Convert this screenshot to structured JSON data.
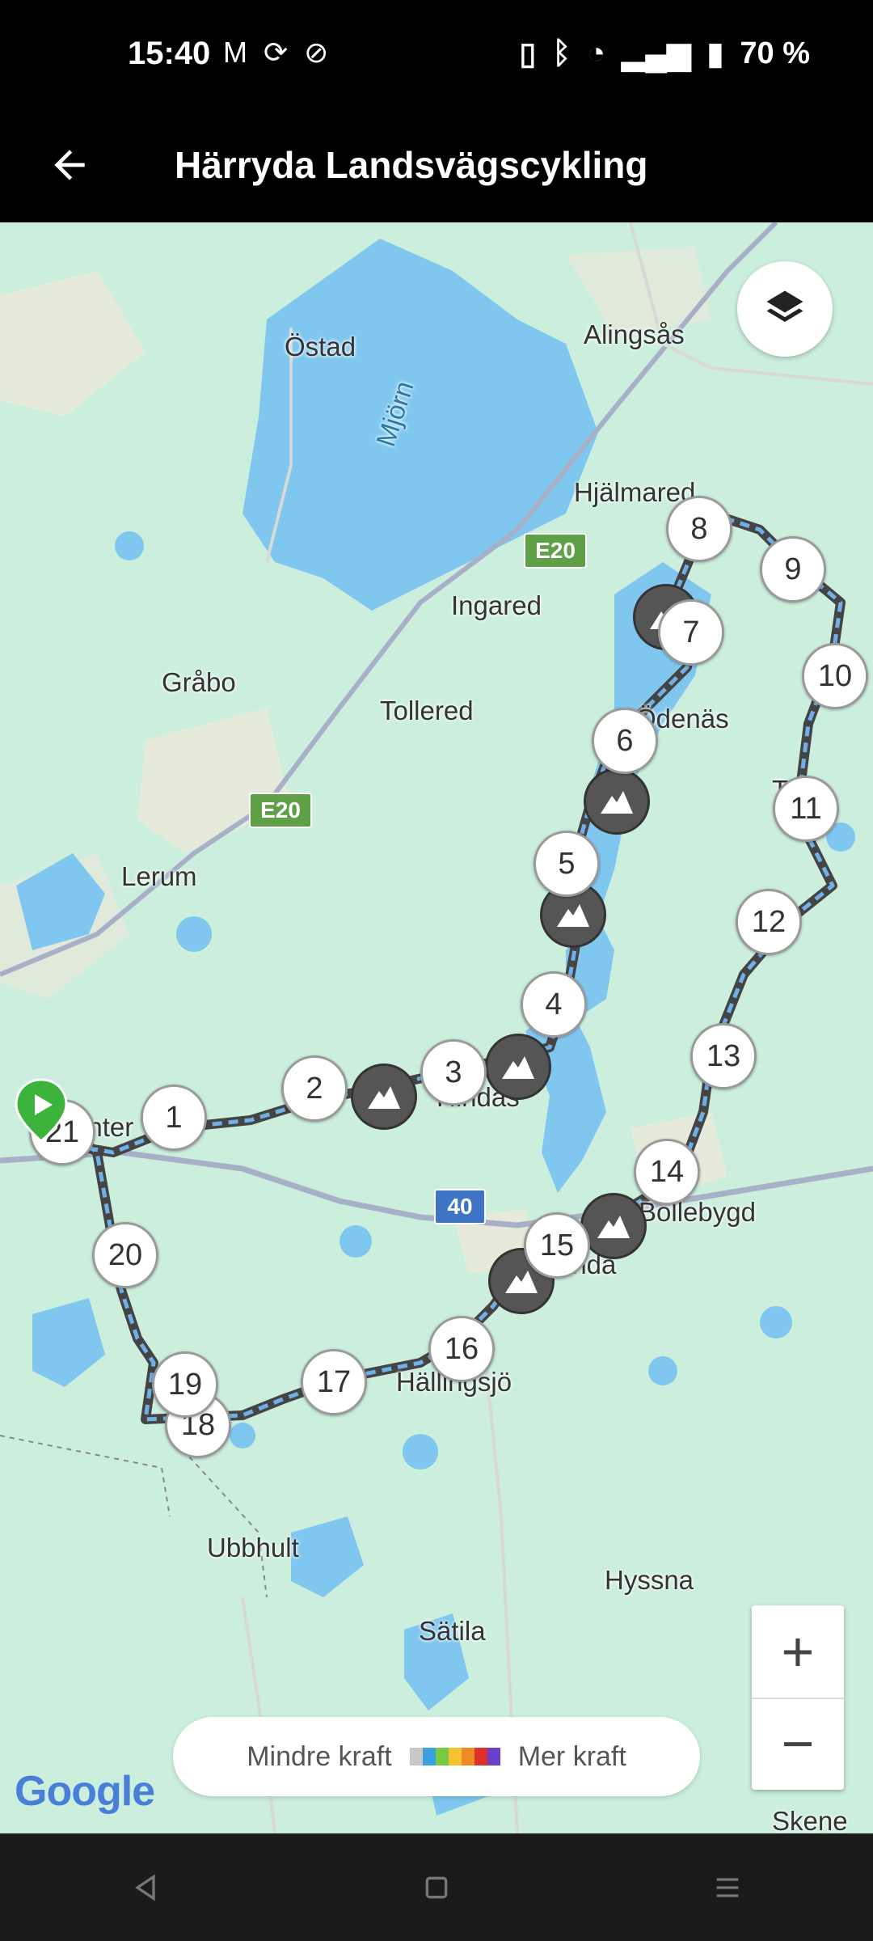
{
  "status_bar": {
    "time": "15:40",
    "left_icons": [
      "gmail-icon",
      "sync-icon",
      "no-disturb-icon"
    ],
    "battery": "70 %"
  },
  "header": {
    "title": "Härryda Landsvägscykling"
  },
  "map": {
    "places": [
      {
        "id": "ostad",
        "label": "Östad"
      },
      {
        "id": "alingsas",
        "label": "Alingsås"
      },
      {
        "id": "mjorn",
        "label": "Mjörn"
      },
      {
        "id": "hjalmared",
        "label": "Hjälmared"
      },
      {
        "id": "ingared",
        "label": "Ingared"
      },
      {
        "id": "grabo",
        "label": "Gråbo"
      },
      {
        "id": "tollered",
        "label": "Tollered"
      },
      {
        "id": "odenas",
        "label": "Ödenäs"
      },
      {
        "id": "lerum",
        "label": "Lerum"
      },
      {
        "id": "hindas",
        "label": "Hindås"
      },
      {
        "id": "bollebygd",
        "label": "Bollebygd"
      },
      {
        "id": "rannebergen",
        "label": "anter"
      },
      {
        "id": "hallingsjo",
        "label": "Hällingsjö"
      },
      {
        "id": "rinda",
        "label": "inda"
      },
      {
        "id": "ubbhult",
        "label": "Ubbhult"
      },
      {
        "id": "hyssna",
        "label": "Hyssna"
      },
      {
        "id": "satila",
        "label": "Sätila"
      },
      {
        "id": "skene",
        "label": "Skene"
      },
      {
        "id": "torsjo",
        "label": "Töö"
      }
    ],
    "road_shields": [
      {
        "label": "E20"
      },
      {
        "label": "E20"
      },
      {
        "label": "40"
      }
    ],
    "waypoints": [
      "1",
      "2",
      "3",
      "4",
      "5",
      "6",
      "7",
      "8",
      "9",
      "10",
      "11",
      "12",
      "13",
      "14",
      "15",
      "16",
      "17",
      "18",
      "19",
      "20",
      "21"
    ]
  },
  "legend": {
    "less": "Mindre kraft",
    "more": "Mer kraft",
    "colors": [
      "#c8c8c8",
      "#3aa0e0",
      "#7ac943",
      "#f4c430",
      "#f08a24",
      "#e0302a",
      "#6a3fc9"
    ]
  },
  "zoom": {
    "in": "+",
    "out": "−"
  },
  "attribution": "Google",
  "colors": {
    "map_bg": "#cbeedd",
    "water": "#7fc7ef",
    "road": "#a8b0c8",
    "route": "#444444"
  }
}
